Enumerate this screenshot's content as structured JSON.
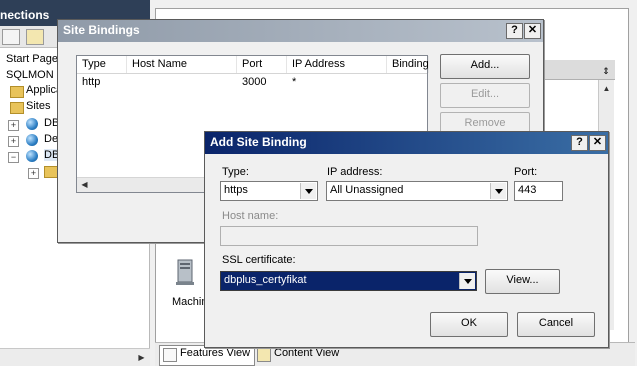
{
  "background": {
    "connections_header": "nections",
    "tree": [
      {
        "label": "Start Page"
      },
      {
        "label": "SQLMON ("
      },
      {
        "label": "Applica"
      },
      {
        "label": "Sites"
      },
      {
        "label": "DB"
      },
      {
        "label": "De"
      },
      {
        "label": "DB"
      }
    ],
    "machine_label": "Machin",
    "tabs": {
      "features": "Features View",
      "content": "Content View"
    }
  },
  "site_bindings": {
    "title": "Site Bindings",
    "help_label": "?",
    "close_label": "✕",
    "columns": [
      "Type",
      "Host Name",
      "Port",
      "IP Address",
      "Binding"
    ],
    "rows": [
      {
        "type": "http",
        "host": "",
        "port": "3000",
        "ip": "*"
      }
    ],
    "buttons": {
      "add": "Add...",
      "edit": "Edit...",
      "remove": "Remove"
    }
  },
  "add_binding": {
    "title": "Add Site Binding",
    "help_label": "?",
    "close_label": "✕",
    "type_label": "Type:",
    "type_value": "https",
    "ip_label": "IP address:",
    "ip_value": "All Unassigned",
    "port_label": "Port:",
    "port_value": "443",
    "host_label": "Host name:",
    "host_value": "",
    "ssl_label": "SSL certificate:",
    "ssl_value": "dbplus_certyfikat",
    "view_label": "View...",
    "ok_label": "OK",
    "cancel_label": "Cancel"
  }
}
